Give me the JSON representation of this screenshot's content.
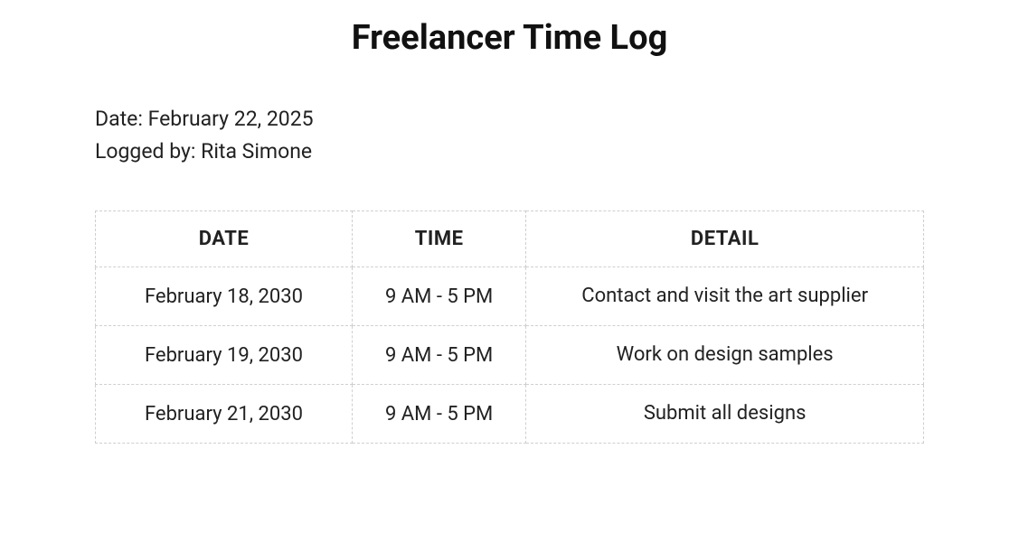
{
  "title": "Freelancer Time Log",
  "meta": {
    "date_label": "Date: ",
    "date_value": "February 22, 2025",
    "logged_label": "Logged by: ",
    "logged_value": "Rita Simone"
  },
  "table": {
    "headers": {
      "date": "DATE",
      "time": "TIME",
      "detail": "DETAIL"
    },
    "rows": [
      {
        "date": "February 18, 2030",
        "time": "9 AM - 5 PM",
        "detail": "Contact and visit the art supplier"
      },
      {
        "date": "February 19, 2030",
        "time": "9 AM - 5 PM",
        "detail": "Work on design samples"
      },
      {
        "date": "February 21, 2030",
        "time": "9 AM - 5 PM",
        "detail": "Submit all designs"
      }
    ]
  }
}
